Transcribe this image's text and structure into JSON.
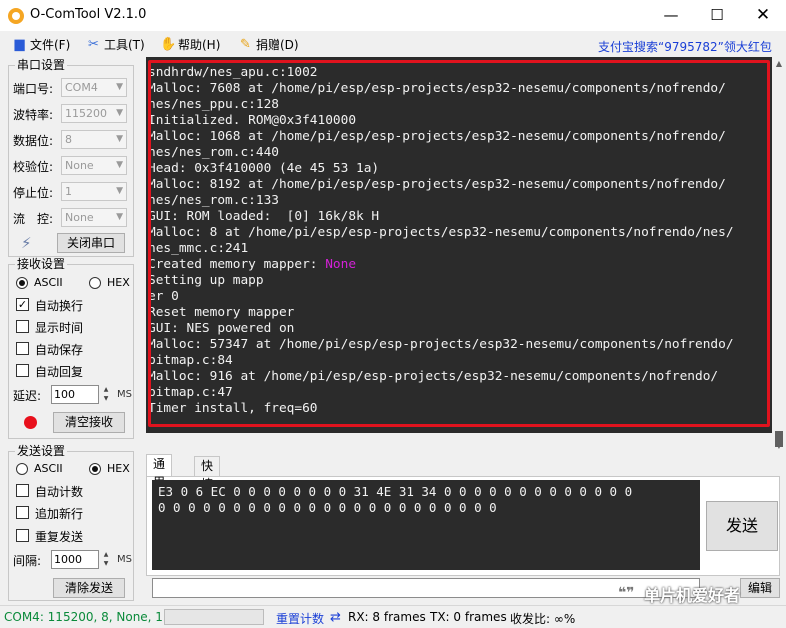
{
  "window": {
    "title": "O-ComTool V2.1.0",
    "minimize": "—",
    "maximize": "☐",
    "close": "✕"
  },
  "menu": {
    "items": [
      "文件(F)",
      "工具(T)",
      "帮助(H)",
      "捐赠(D)"
    ],
    "link": "支付宝搜索“9795782”领大红包"
  },
  "serial": {
    "title": "串口设置",
    "port_label": "端口号:",
    "port_value": "COM4",
    "baud_label": "波特率:",
    "baud_value": "115200",
    "data_label": "数据位:",
    "data_value": "8",
    "parity_label": "校验位:",
    "parity_value": "None",
    "stop_label": "停止位:",
    "stop_value": "1",
    "flow_label": "流　控:",
    "flow_value": "None",
    "close_button": "关闭串口"
  },
  "receive": {
    "title": "接收设置",
    "ascii_label": "ASCII",
    "hex_label": "HEX",
    "mode_selected": "ASCII",
    "auto_wrap": "自动换行",
    "auto_wrap_checked": true,
    "show_time": "显示时间",
    "show_time_checked": false,
    "auto_save": "自动保存",
    "auto_save_checked": false,
    "auto_reply": "自动回复",
    "auto_reply_checked": false,
    "delay_label": "延迟:",
    "delay_value": "100",
    "delay_unit": "MS",
    "clear_button": "清空接收",
    "led_color": "#e8101c"
  },
  "send": {
    "title": "发送设置",
    "ascii_label": "ASCII",
    "hex_label": "HEX",
    "mode_selected": "HEX",
    "auto_count": "自动计数",
    "auto_count_checked": false,
    "append_newline": "追加新行",
    "append_newline_checked": false,
    "repeat_send": "重复发送",
    "repeat_send_checked": false,
    "interval_label": "间隔:",
    "interval_value": "1000",
    "interval_unit": "MS",
    "clear_button": "清除发送"
  },
  "terminal": {
    "lines": [
      "sndhrdw/nes_apu.c:1002",
      "Malloc: 7608 at /home/pi/esp/esp-projects/esp32-nesemu/components/nofrendo/",
      "nes/nes_ppu.c:128",
      "Initialized. ROM@0x3f410000",
      "Malloc: 1068 at /home/pi/esp/esp-projects/esp32-nesemu/components/nofrendo/",
      "nes/nes_rom.c:440",
      "Head: 0x3f410000 (4e 45 53 1a)",
      "Malloc: 8192 at /home/pi/esp/esp-projects/esp32-nesemu/components/nofrendo/",
      "nes/nes_rom.c:133",
      "GUI: ROM loaded:  [0] 16k/8k H",
      "Malloc: 8 at /home/pi/esp/esp-projects/esp32-nesemu/components/nofrendo/nes/",
      "nes_mmc.c:241",
      "Created memory mapper: ",
      "Setting up mapp",
      "er 0",
      "Reset memory mapper",
      "GUI: NES powered on",
      "Malloc: 57347 at /home/pi/esp/esp-projects/esp32-nesemu/components/nofrendo/",
      "bitmap.c:84",
      "Malloc: 916 at /home/pi/esp/esp-projects/esp32-nesemu/components/nofrendo/",
      "bitmap.c:47",
      "Timer install, freq=60"
    ],
    "mapper_name": "None",
    "highlight_color": "#d321d6",
    "frame_color": "#e0131e"
  },
  "sendarea": {
    "tab_general": "通用",
    "tab_quick": "快捷",
    "hex_line1": "E3 0 6 EC 0 0 0 0 0 0 0 0 31 4E 31 34 0 0 0 0 0 0 0 0 0 0 0 0 0",
    "hex_line2": "0 0 0 0 0 0 0 0 0 0 0 0 0 0 0 0 0 0 0 0 0 0 0",
    "send_button": "发送",
    "edit_button": "编辑",
    "watermark": "单片机爱好者"
  },
  "status": {
    "com_info": "COM4: 115200, 8, None, 1",
    "reset_count": "重置计数",
    "rx": "RX: 8 frames",
    "tx": "TX: 0 frames",
    "ratio": "收发比:  ∞%"
  }
}
